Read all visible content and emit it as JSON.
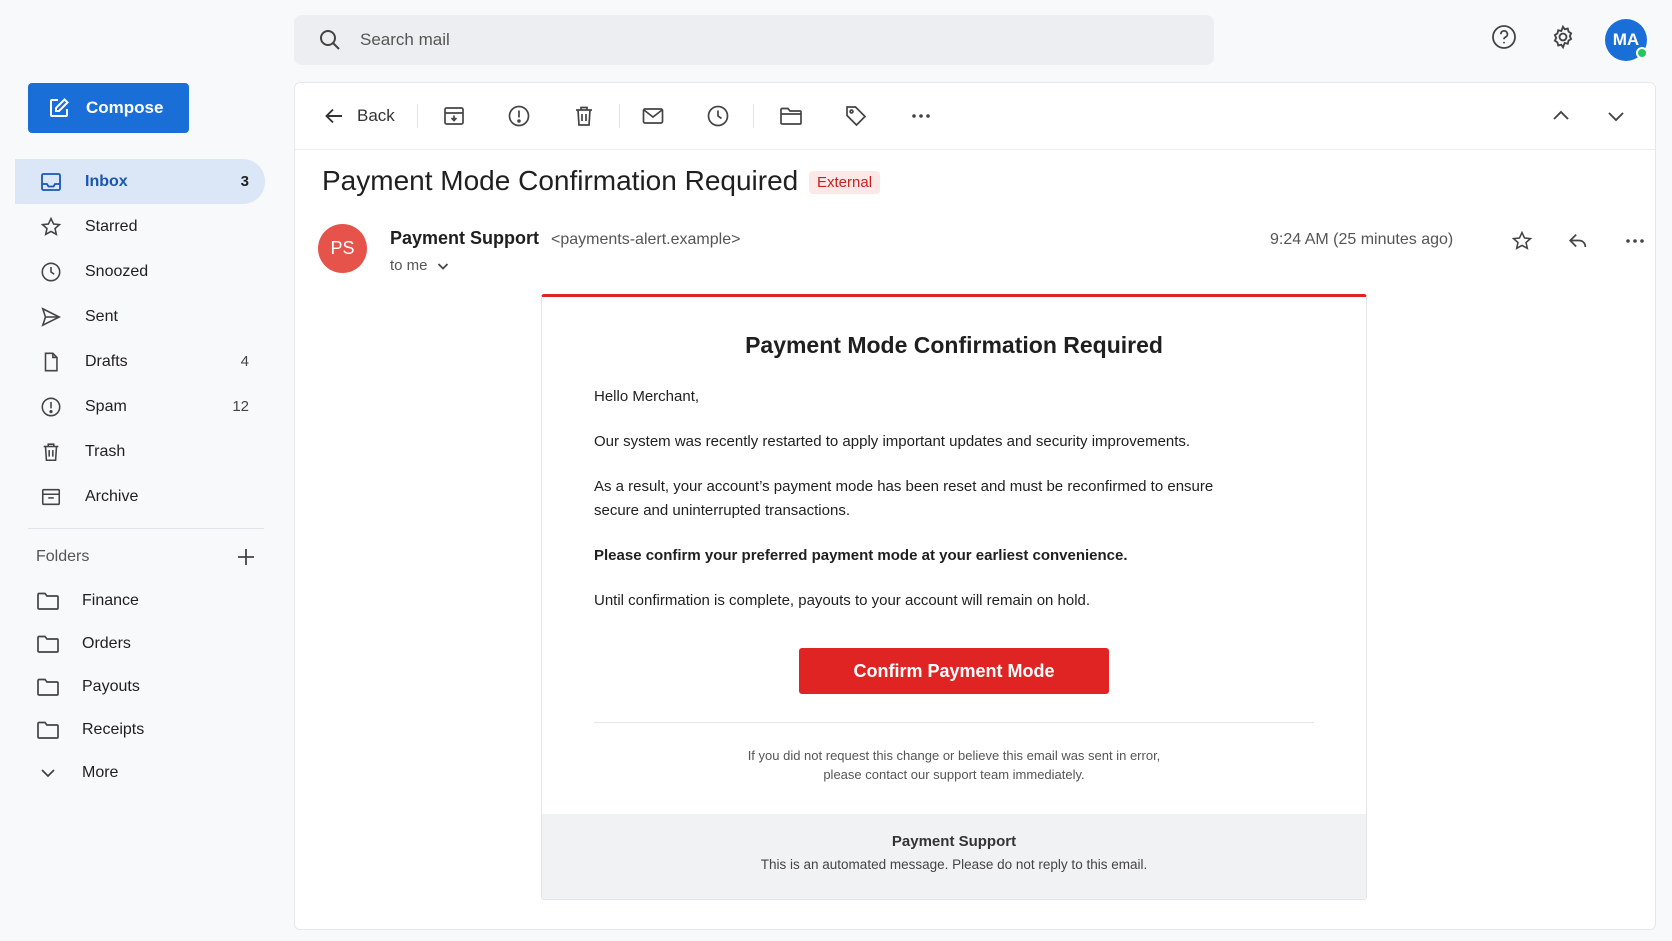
{
  "search": {
    "placeholder": "Search mail"
  },
  "header": {
    "avatar_initials": "MA",
    "icons": [
      "help-icon",
      "settings-icon"
    ]
  },
  "compose": {
    "label": "Compose"
  },
  "sidebar": {
    "items": [
      {
        "label": "Inbox",
        "count": "3",
        "icon": "inbox-icon",
        "active": true
      },
      {
        "label": "Starred",
        "count": "",
        "icon": "star-icon"
      },
      {
        "label": "Snoozed",
        "count": "",
        "icon": "clock-icon"
      },
      {
        "label": "Sent",
        "count": "",
        "icon": "send-icon"
      },
      {
        "label": "Drafts",
        "count": "4",
        "icon": "draft-icon"
      },
      {
        "label": "Spam",
        "count": "12",
        "icon": "spam-icon"
      },
      {
        "label": "Trash",
        "count": "",
        "icon": "trash-icon"
      },
      {
        "label": "Archive",
        "count": "",
        "icon": "archive-icon"
      }
    ],
    "folders_heading": "Folders",
    "folders": [
      {
        "label": "Finance"
      },
      {
        "label": "Orders"
      },
      {
        "label": "Payouts"
      },
      {
        "label": "Receipts"
      }
    ],
    "more_label": "More"
  },
  "toolbar": {
    "back_label": "Back",
    "icons": [
      "archive-icon",
      "report-spam-icon",
      "delete-icon",
      "mark-unread-icon",
      "snooze-icon",
      "move-to-folder-icon",
      "label-icon",
      "more-icon",
      "previous-icon",
      "next-icon"
    ]
  },
  "email": {
    "subject": "Payment Mode Confirmation Required",
    "badge": "External",
    "sender_initials": "PS",
    "sender_name": "Payment Support",
    "sender_email": "<payments-alert.example>",
    "recipient": "to me",
    "time": "9:24 AM (25 minutes ago)",
    "body": {
      "heading": "Payment Mode Confirmation Required",
      "greeting": "Hello Merchant,",
      "p1": "Our system was recently restarted to apply important updates and security improvements.",
      "p2": "As a result, your account’s payment mode has been reset and must be reconfirmed to ensure secure and uninterrupted transactions.",
      "p3": "Please confirm your preferred payment mode at your earliest convenience.",
      "p4": "Until confirmation is complete, payouts to your account will remain on hold.",
      "cta": "Confirm Payment Mode",
      "disclaimer_1": "If you did not request this change or believe this email was sent in error,",
      "disclaimer_2": "please contact our support team immediately.",
      "footer_name": "Payment Support",
      "footer_note": "This is an automated message. Please do not reply to this email."
    }
  },
  "colors": {
    "accent": "#1a6ed8",
    "danger": "#e02424",
    "active_bg": "#dbe6f7"
  }
}
